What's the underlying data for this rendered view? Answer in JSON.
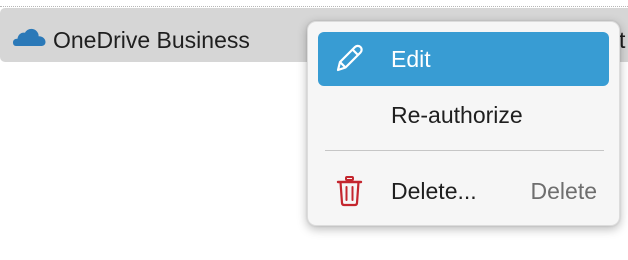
{
  "row": {
    "icon": "cloud-icon",
    "label": "OneDrive Business",
    "trailing_text": "t"
  },
  "context_menu": {
    "items": [
      {
        "label": "Edit",
        "icon": "pencil-icon",
        "highlighted": true
      },
      {
        "label": "Re-authorize"
      },
      {
        "label": "Delete...",
        "icon": "trash-icon",
        "shortcut": "Delete"
      }
    ]
  },
  "colors": {
    "highlight": "#389cd3",
    "cloud": "#2b79b8",
    "trash": "#c4262e",
    "row_background": "#d6d6d6"
  }
}
